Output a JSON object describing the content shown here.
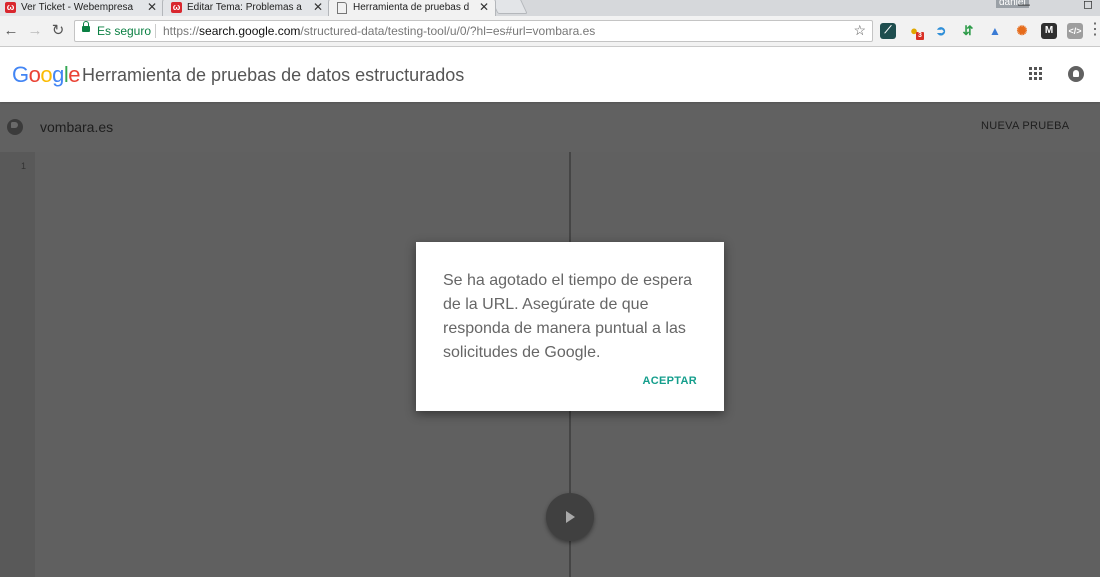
{
  "browser": {
    "tabs": [
      {
        "title": "Ver Ticket - Webempresa",
        "favicon": "w",
        "active": false
      },
      {
        "title": "Editar Tema: Problemas a",
        "favicon": "w",
        "active": false
      },
      {
        "title": "Herramienta de pruebas d",
        "favicon": "doc",
        "active": true
      }
    ],
    "tab_close": "✕",
    "user": "daniel",
    "minimize": "—",
    "restore": "◻",
    "secure_label": "Es seguro",
    "url_scheme": "https://",
    "url_host": "search.google.com",
    "url_path": "/structured-data/testing-tool/u/0/?hl=es#url=vombara.es",
    "ext_badge": "3",
    "colors": {
      "secure": "#0b8043"
    }
  },
  "app": {
    "logo": "Google",
    "logo_colors": [
      "#4285f4",
      "#ea4335",
      "#fbbc05",
      "#4285f4",
      "#34a853",
      "#ea4335"
    ],
    "title": "Herramienta de pruebas de datos estructurados"
  },
  "tool": {
    "tested_url": "vombara.es",
    "new_test": "NUEVA PRUEBA",
    "line_number": "1"
  },
  "dialog": {
    "message": "Se ha agotado el tiempo de espera de la URL. Asegúrate de que responda de manera puntual a las solicitudes de Google.",
    "accept": "ACEPTAR",
    "accent_color": "#149e8c"
  }
}
